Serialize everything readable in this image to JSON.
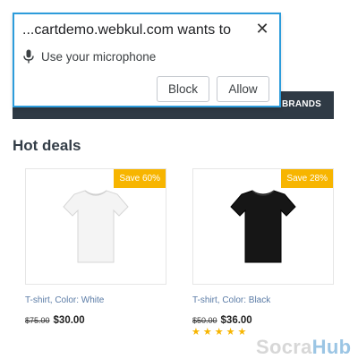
{
  "permission_prompt": {
    "title": "...cartdemo.webkul.com wants to",
    "permission": "Use your microphone",
    "permission_icon": "microphone-icon",
    "close_icon": "close-icon",
    "block_label": "Block",
    "allow_label": "Allow"
  },
  "navbar": {
    "brands_label": "BRANDS"
  },
  "section": {
    "title": "Hot deals"
  },
  "products": [
    {
      "badge": "Save 60%",
      "name": "T-shirt, Color: White",
      "old_price": "$75.00",
      "price": "$30.00",
      "shirt_color": "#f2f2f2"
    },
    {
      "badge": "Save 28%",
      "name": "T-shirt, Color: Black",
      "old_price": "$50.00",
      "price": "$36.00",
      "shirt_color": "#161616",
      "rating": 5
    }
  ],
  "watermark": {
    "part1": "Socra",
    "part2": "Hub"
  },
  "colors": {
    "accent": "#2d9cdb",
    "badge": "#f7b500",
    "nav": "#2f3a45",
    "link": "#5a7ba6"
  }
}
